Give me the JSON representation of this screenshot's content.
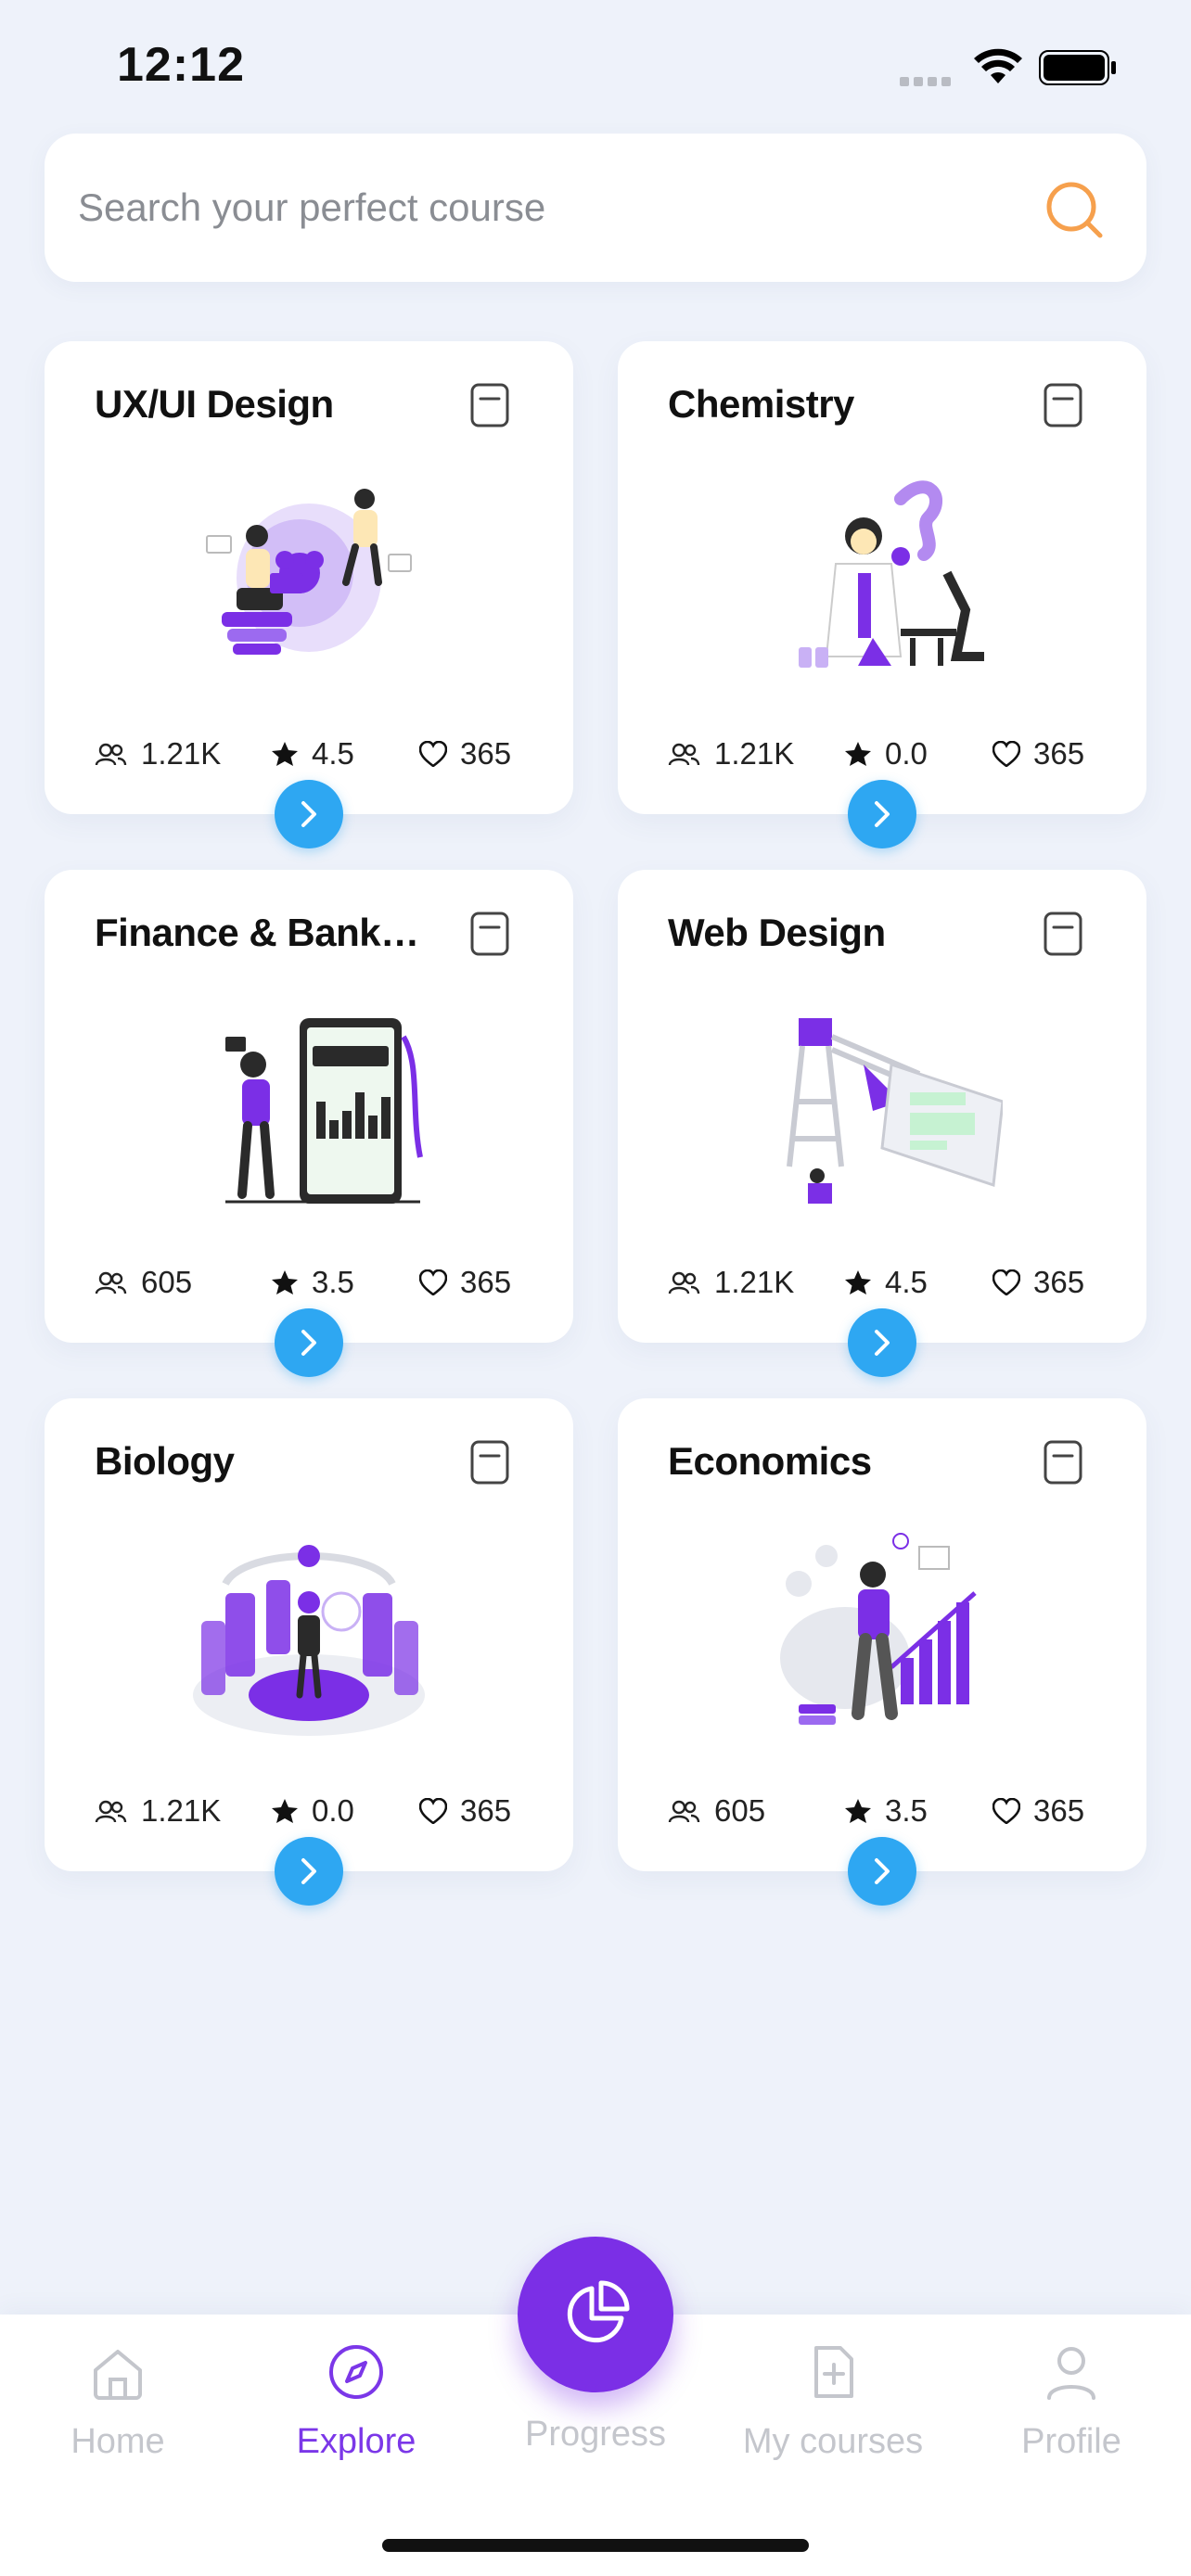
{
  "status_bar": {
    "time": "12:12"
  },
  "search": {
    "placeholder": "Search your perfect course"
  },
  "courses": [
    {
      "title": "UX/UI Design",
      "learners": "1.21K",
      "rating": "4.5",
      "likes": "365",
      "illustration": "designer-illustration"
    },
    {
      "title": "Chemistry",
      "learners": "1.21K",
      "rating": "0.0",
      "likes": "365",
      "illustration": "chemist-illustration"
    },
    {
      "title": "Finance & Banking",
      "learners": "605",
      "rating": "3.5",
      "likes": "365",
      "illustration": "finance-illustration"
    },
    {
      "title": "Web Design",
      "learners": "1.21K",
      "rating": "4.5",
      "likes": "365",
      "illustration": "web-design-illustration"
    },
    {
      "title": "Biology",
      "learners": "1.21K",
      "rating": "0.0",
      "likes": "365",
      "illustration": "biology-illustration"
    },
    {
      "title": "Economics",
      "learners": "605",
      "rating": "3.5",
      "likes": "365",
      "illustration": "economics-illustration"
    }
  ],
  "nav": {
    "home": "Home",
    "explore": "Explore",
    "progress": "Progress",
    "my_courses": "My courses",
    "profile": "Profile",
    "active": "explore"
  },
  "colors": {
    "accent": "#7b2fe6",
    "arrow": "#2ea7f2",
    "search_icon": "#f6a04d",
    "background": "#eef2fa"
  }
}
